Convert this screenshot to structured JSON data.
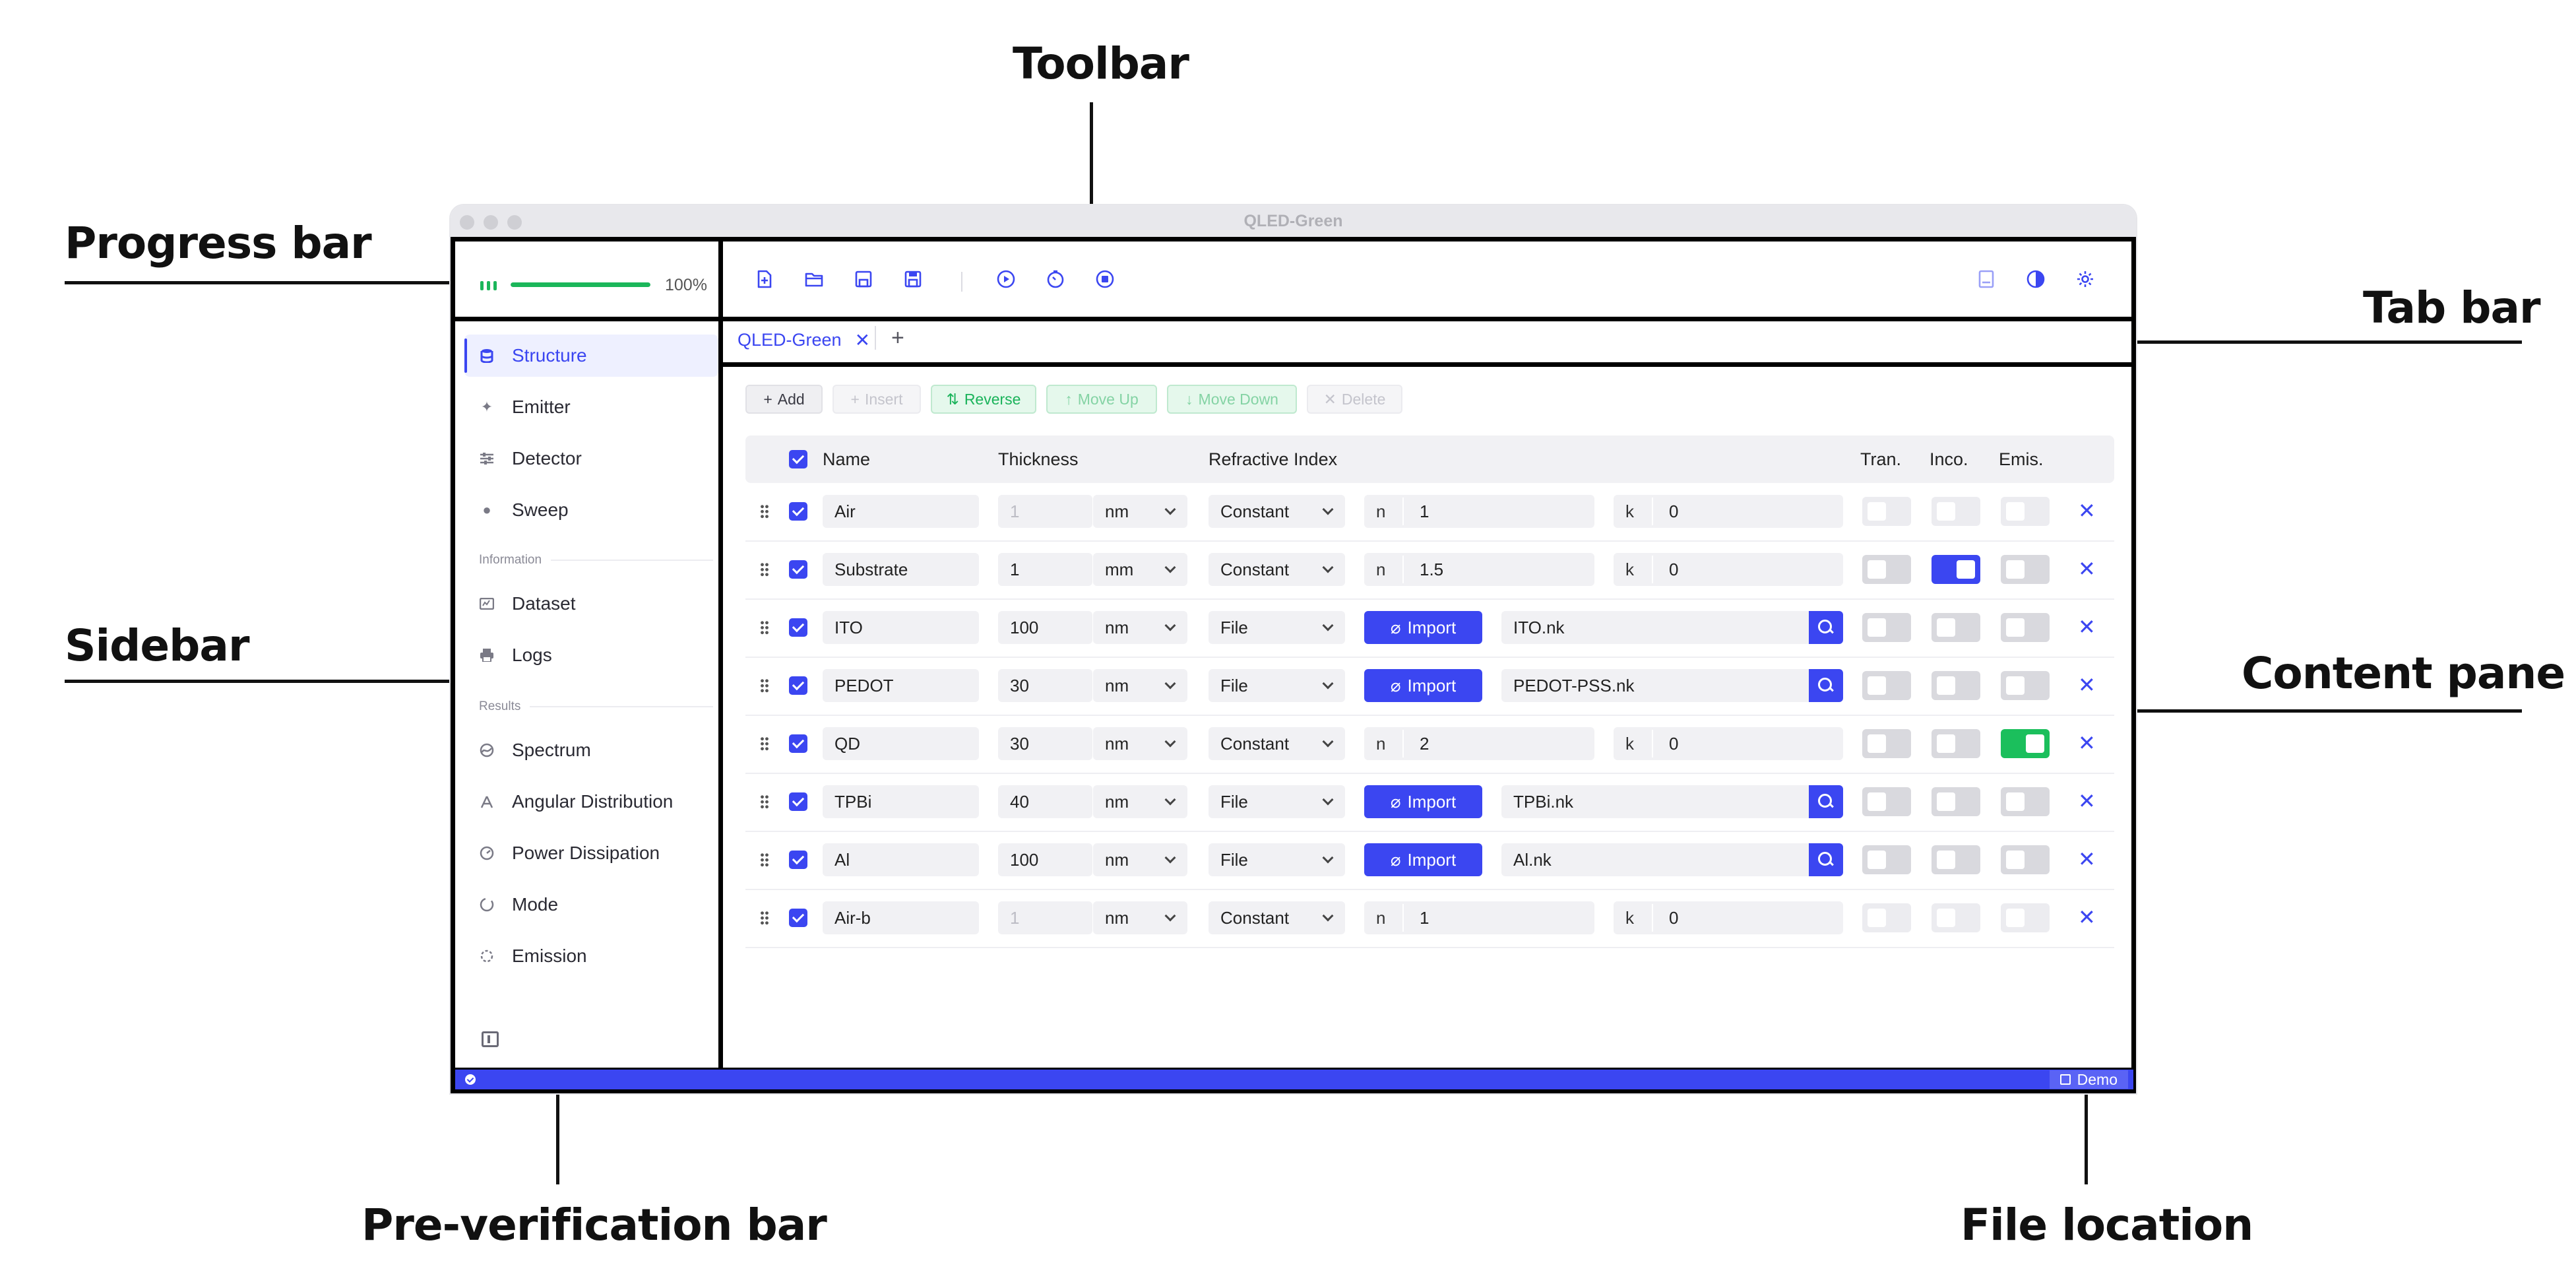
{
  "annotations": {
    "toolbar": "Toolbar",
    "progress_bar": "Progress bar",
    "tab_bar": "Tab bar",
    "sidebar": "Sidebar",
    "content_pane": "Content pane",
    "pre_verification_bar": "Pre-verification bar",
    "file_location": "File location"
  },
  "window": {
    "title": "QLED-Green"
  },
  "progress": {
    "value": 100,
    "label": "100%"
  },
  "sidebar": {
    "items": [
      {
        "label": "Structure",
        "icon": "database-icon",
        "active": true
      },
      {
        "label": "Emitter",
        "icon": "sparkle-icon"
      },
      {
        "label": "Detector",
        "icon": "sliders-icon"
      },
      {
        "label": "Sweep",
        "icon": "sphere-icon"
      }
    ],
    "section_information": "Information",
    "info_items": [
      {
        "label": "Dataset",
        "icon": "dataset-icon"
      },
      {
        "label": "Logs",
        "icon": "printer-icon"
      }
    ],
    "section_results": "Results",
    "result_items": [
      {
        "label": "Spectrum",
        "icon": "spectrum-icon"
      },
      {
        "label": "Angular Distribution",
        "icon": "angular-icon"
      },
      {
        "label": "Power Dissipation",
        "icon": "gauge-icon"
      },
      {
        "label": "Mode",
        "icon": "circle-dashed-icon"
      },
      {
        "label": "Emission",
        "icon": "sun-icon"
      }
    ]
  },
  "toolbar": {
    "left_icons": [
      "new-file-icon",
      "open-folder-icon",
      "save-icon",
      "save-as-icon"
    ],
    "run_icons": [
      "play-icon",
      "timer-icon",
      "stop-icon"
    ],
    "right_icons": [
      "notebook-icon",
      "theme-icon",
      "gear-icon"
    ]
  },
  "tabs": [
    {
      "label": "QLED-Green"
    }
  ],
  "actions": {
    "add": "Add",
    "insert": "Insert",
    "reverse": "Reverse",
    "move_up": "Move Up",
    "move_down": "Move Down",
    "delete": "Delete"
  },
  "table": {
    "headers": {
      "name": "Name",
      "thickness": "Thickness",
      "refractive_index": "Refractive Index",
      "tran": "Tran.",
      "inco": "Inco.",
      "emis": "Emis."
    },
    "import_label": "Import",
    "n_label": "n",
    "k_label": "k",
    "rows": [
      {
        "name": "Air",
        "thickness": "1",
        "unit": "nm",
        "mode": "Constant",
        "n": "1",
        "k": "0",
        "tran": "faded",
        "inco": "faded",
        "emis": "faded",
        "thick_dim": true
      },
      {
        "name": "Substrate",
        "thickness": "1",
        "unit": "mm",
        "mode": "Constant",
        "n": "1.5",
        "k": "0",
        "tran": "off",
        "inco": "on-blue",
        "emis": "off"
      },
      {
        "name": "ITO",
        "thickness": "100",
        "unit": "nm",
        "mode": "File",
        "file": "ITO.nk",
        "tran": "off",
        "inco": "off",
        "emis": "off"
      },
      {
        "name": "PEDOT",
        "thickness": "30",
        "unit": "nm",
        "mode": "File",
        "file": "PEDOT-PSS.nk",
        "tran": "off",
        "inco": "off",
        "emis": "off"
      },
      {
        "name": "QD",
        "thickness": "30",
        "unit": "nm",
        "mode": "Constant",
        "n": "2",
        "k": "0",
        "tran": "off",
        "inco": "off",
        "emis": "on-green"
      },
      {
        "name": "TPBi",
        "thickness": "40",
        "unit": "nm",
        "mode": "File",
        "file": "TPBi.nk",
        "tran": "off",
        "inco": "off",
        "emis": "off"
      },
      {
        "name": "Al",
        "thickness": "100",
        "unit": "nm",
        "mode": "File",
        "file": "Al.nk",
        "tran": "off",
        "inco": "off",
        "emis": "off"
      },
      {
        "name": "Air-b",
        "thickness": "1",
        "unit": "nm",
        "mode": "Constant",
        "n": "1",
        "k": "0",
        "tran": "faded",
        "inco": "faded",
        "emis": "faded",
        "thick_dim": true
      }
    ]
  },
  "statusbar": {
    "file_location": "Demo"
  },
  "colors": {
    "accent": "#3b46f1",
    "success": "#1bb65a"
  }
}
